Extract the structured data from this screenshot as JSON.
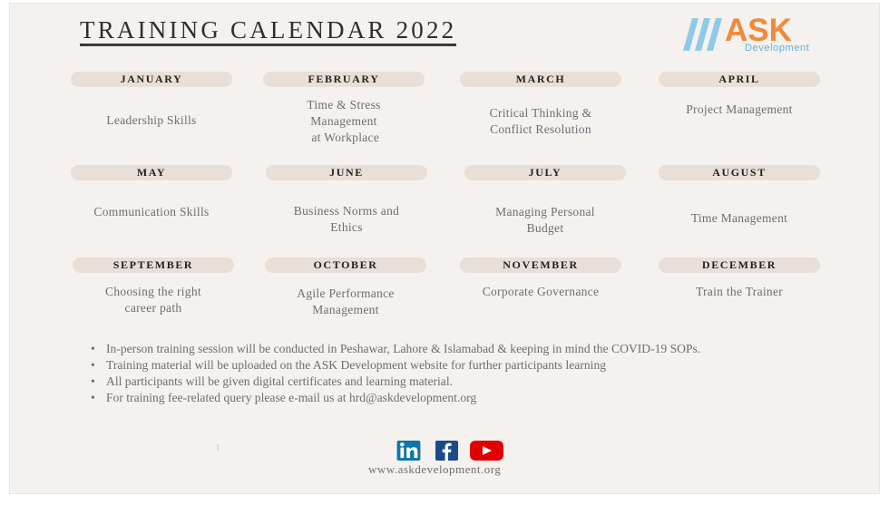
{
  "header": {
    "title": "TRAINING CALENDAR 2022",
    "logo": {
      "primary": "ASK",
      "secondary": "Development",
      "icon": "slashes-logo-icon"
    }
  },
  "colors": {
    "background": "#f5f1ee",
    "pill": "#e8e0d8",
    "logo_orange": "#f08a3a",
    "logo_blue": "#5fb2dc",
    "linkedin": "#0e76a8",
    "facebook": "#1e4a8c",
    "youtube": "#e00000"
  },
  "calendar": [
    {
      "month": "JANUARY",
      "topic": [
        "Leadership Skills"
      ]
    },
    {
      "month": "FEBRUARY",
      "topic": [
        "Time & Stress",
        "Management",
        " at Workplace"
      ]
    },
    {
      "month": "MARCH",
      "topic": [
        "Critical Thinking &",
        "Conflict Resolution"
      ]
    },
    {
      "month": "APRIL",
      "topic": [
        "Project Management"
      ]
    },
    {
      "month": "MAY",
      "topic": [
        "Communication Skills"
      ]
    },
    {
      "month": "JUNE",
      "topic": [
        "Business Norms and",
        "Ethics"
      ]
    },
    {
      "month": "JULY",
      "topic": [
        "Managing Personal",
        "Budget"
      ]
    },
    {
      "month": "AUGUST",
      "topic": [
        "Time Management"
      ]
    },
    {
      "month": "SEPTEMBER",
      "topic": [
        "Choosing the right",
        "career path"
      ]
    },
    {
      "month": "OCTOBER",
      "topic": [
        "Agile Performance",
        "Management"
      ]
    },
    {
      "month": "NOVEMBER",
      "topic": [
        "Corporate Governance"
      ]
    },
    {
      "month": "DECEMBER",
      "topic": [
        "Train the Trainer"
      ]
    }
  ],
  "notes": [
    "In-person training session will be conducted in Peshawar, Lahore & Islamabad & keeping in mind the COVID-19 SOPs.",
    "Training material will be uploaded on the ASK Development website for further participants learning",
    "All participants will be given digital certificates and learning material.",
    "For training fee-related query please e-mail us at hrd@askdevelopment.org"
  ],
  "footer": {
    "page_number": "1",
    "social": [
      {
        "name": "linkedin-icon",
        "label": "in"
      },
      {
        "name": "facebook-icon",
        "label": "f"
      },
      {
        "name": "youtube-icon",
        "label": "play"
      }
    ],
    "website": "www.askdevelopment.org"
  }
}
